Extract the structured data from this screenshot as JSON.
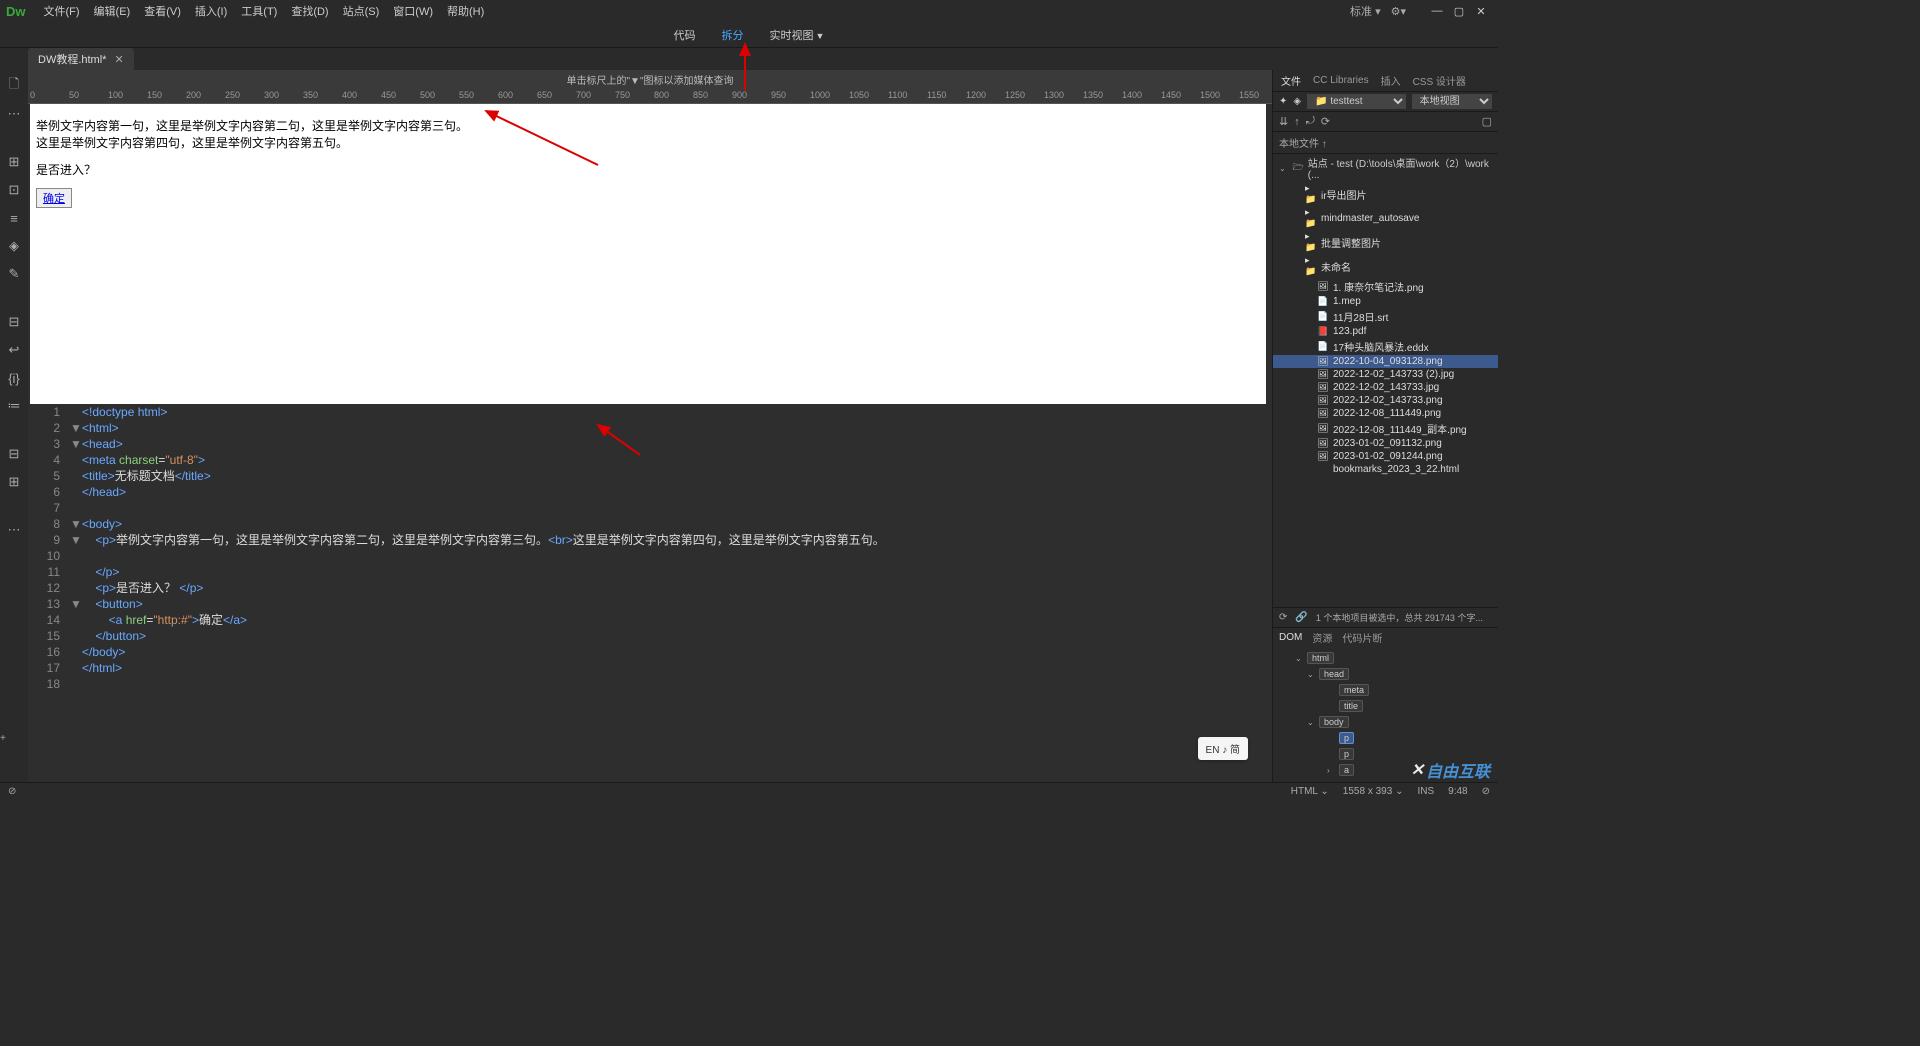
{
  "app": {
    "logo": "Dw",
    "standard": "标准 ▾"
  },
  "menus": [
    "文件(F)",
    "编辑(E)",
    "查看(V)",
    "插入(I)",
    "工具(T)",
    "查找(D)",
    "站点(S)",
    "窗口(W)",
    "帮助(H)"
  ],
  "views": {
    "code": "代码",
    "split": "拆分",
    "live": "实时视图"
  },
  "tab": {
    "filename": "DW教程.html*"
  },
  "mediaHint": "单击标尺上的\"▼\"图标以添加媒体查询",
  "rulerTicks": [
    0,
    50,
    100,
    150,
    200,
    250,
    300,
    350,
    400,
    450,
    500,
    550,
    600,
    650,
    700,
    750,
    800,
    850,
    900,
    950,
    1000,
    1050,
    1100,
    1150,
    1200,
    1250,
    1300,
    1350,
    1400,
    1450,
    1500,
    1550
  ],
  "preview": {
    "p1a": "举例文字内容第一句，这里是举例文字内容第二句，这里是举例文字内容第三句。",
    "p1b": "这里是举例文字内容第四句，这里是举例文字内容第五句。",
    "p2": "是否进入？",
    "button": "确定"
  },
  "code": {
    "lines": [
      {
        "n": 1,
        "f": "",
        "html": "<span class='tag'>&lt;!doctype html&gt;</span>"
      },
      {
        "n": 2,
        "f": "▼",
        "html": "<span class='tag'>&lt;html&gt;</span>"
      },
      {
        "n": 3,
        "f": "▼",
        "html": "<span class='tag'>&lt;head&gt;</span>"
      },
      {
        "n": 4,
        "f": "",
        "html": "<span class='tag'>&lt;meta</span> <span class='attr-name'>charset</span>=<span class='attr-val'>\"utf-8\"</span><span class='tag'>&gt;</span>"
      },
      {
        "n": 5,
        "f": "",
        "html": "<span class='tag'>&lt;title&gt;</span><span class='text-c'>无标题文档</span><span class='tag'>&lt;/title&gt;</span>"
      },
      {
        "n": 6,
        "f": "",
        "html": "<span class='tag'>&lt;/head&gt;</span>"
      },
      {
        "n": 7,
        "f": "",
        "html": ""
      },
      {
        "n": 8,
        "f": "▼",
        "html": "<span class='tag'>&lt;body&gt;</span>"
      },
      {
        "n": 9,
        "f": "▼",
        "html": "    <span class='tag'>&lt;p&gt;</span><span class='text-c'>举例文字内容第一句，这里是举例文字内容第二句，这里是举例文字内容第三句。</span><span class='tag'>&lt;br&gt;</span><span class='text-c'>这里是举例文字内容第四句，这里是举例文字内容第五句。</span>"
      },
      {
        "n": 10,
        "f": "",
        "html": ""
      },
      {
        "n": 11,
        "f": "",
        "html": "    <span class='tag'>&lt;/p&gt;</span>"
      },
      {
        "n": 12,
        "f": "",
        "html": "    <span class='tag'>&lt;p&gt;</span><span class='text-c'>是否进入？ </span><span class='tag'>&lt;/p&gt;</span>"
      },
      {
        "n": 13,
        "f": "▼",
        "html": "    <span class='tag'>&lt;button&gt;</span>"
      },
      {
        "n": 14,
        "f": "",
        "html": "        <span class='tag'>&lt;a</span> <span class='attr-name'>href</span>=<span class='attr-val'>\"http:#\"</span><span class='tag'>&gt;</span><span class='text-c'>确定</span><span class='tag'>&lt;/a&gt;</span>"
      },
      {
        "n": 15,
        "f": "",
        "html": "    <span class='tag'>&lt;/button&gt;</span>"
      },
      {
        "n": 16,
        "f": "",
        "html": "<span class='tag'>&lt;/body&gt;</span>"
      },
      {
        "n": 17,
        "f": "",
        "html": "<span class='tag'>&lt;/html&gt;</span>"
      },
      {
        "n": 18,
        "f": "",
        "html": ""
      }
    ]
  },
  "rightPanel": {
    "tabs": [
      "文件",
      "CC Libraries",
      "插入",
      "CSS 设计器"
    ],
    "siteSelect": "test",
    "viewSelect": "本地视图",
    "localFiles": "本地文件 ↑",
    "siteRoot": "站点 - test (D:\\tools\\桌面\\work（2）\\work (...",
    "files": [
      {
        "icon": "▸📁",
        "name": "ir导出图片",
        "indent": 22
      },
      {
        "icon": "▸📁",
        "name": "mindmaster_autosave",
        "indent": 22
      },
      {
        "icon": "▸📁",
        "name": "批量调整图片",
        "indent": 22
      },
      {
        "icon": "▸📁",
        "name": "未命名",
        "indent": 22
      },
      {
        "icon": "🖼",
        "name": "1. 康奈尔笔记法.png",
        "indent": 34
      },
      {
        "icon": "📄",
        "name": "1.mep",
        "indent": 34
      },
      {
        "icon": "📄",
        "name": "11月28日.srt",
        "indent": 34
      },
      {
        "icon": "📕",
        "name": "123.pdf",
        "indent": 34
      },
      {
        "icon": "📄",
        "name": "17种头脑风暴法.eddx",
        "indent": 34
      },
      {
        "icon": "🖼",
        "name": "2022-10-04_093128.png",
        "indent": 34,
        "selected": true
      },
      {
        "icon": "🖼",
        "name": "2022-12-02_143733 (2).jpg",
        "indent": 34
      },
      {
        "icon": "🖼",
        "name": "2022-12-02_143733.jpg",
        "indent": 34
      },
      {
        "icon": "🖼",
        "name": "2022-12-02_143733.png",
        "indent": 34
      },
      {
        "icon": "🖼",
        "name": "2022-12-08_111449.png",
        "indent": 34
      },
      {
        "icon": "🖼",
        "name": "2022-12-08_111449_副本.png",
        "indent": 34
      },
      {
        "icon": "🖼",
        "name": "2023-01-02_091132.png",
        "indent": 34
      },
      {
        "icon": "🖼",
        "name": "2023-01-02_091244.png",
        "indent": 34
      },
      {
        "icon": "</>",
        "name": "bookmarks_2023_3_22.html",
        "indent": 34
      }
    ],
    "footer": "1 个本地项目被选中，总共 291743 个字..."
  },
  "dom": {
    "tabs": [
      "DOM",
      "资源",
      "代码片断"
    ],
    "nodes": [
      {
        "indent": 12,
        "exp": "⌄",
        "tag": "html"
      },
      {
        "indent": 24,
        "exp": "⌄",
        "tag": "head"
      },
      {
        "indent": 44,
        "exp": "",
        "tag": "meta"
      },
      {
        "indent": 44,
        "exp": "",
        "tag": "title"
      },
      {
        "indent": 24,
        "exp": "⌄",
        "tag": "body"
      },
      {
        "indent": 44,
        "exp": "",
        "tag": "p",
        "selected": true,
        "plus": true
      },
      {
        "indent": 44,
        "exp": "",
        "tag": "p"
      },
      {
        "indent": 44,
        "exp": "›",
        "tag": "a"
      }
    ]
  },
  "status": {
    "lang": "HTML",
    "size": "1558 x 393",
    "ins": "INS",
    "time": "9:48",
    "encoding": "⊘"
  },
  "ime": "EN ♪ 简",
  "watermark": "自由互联"
}
